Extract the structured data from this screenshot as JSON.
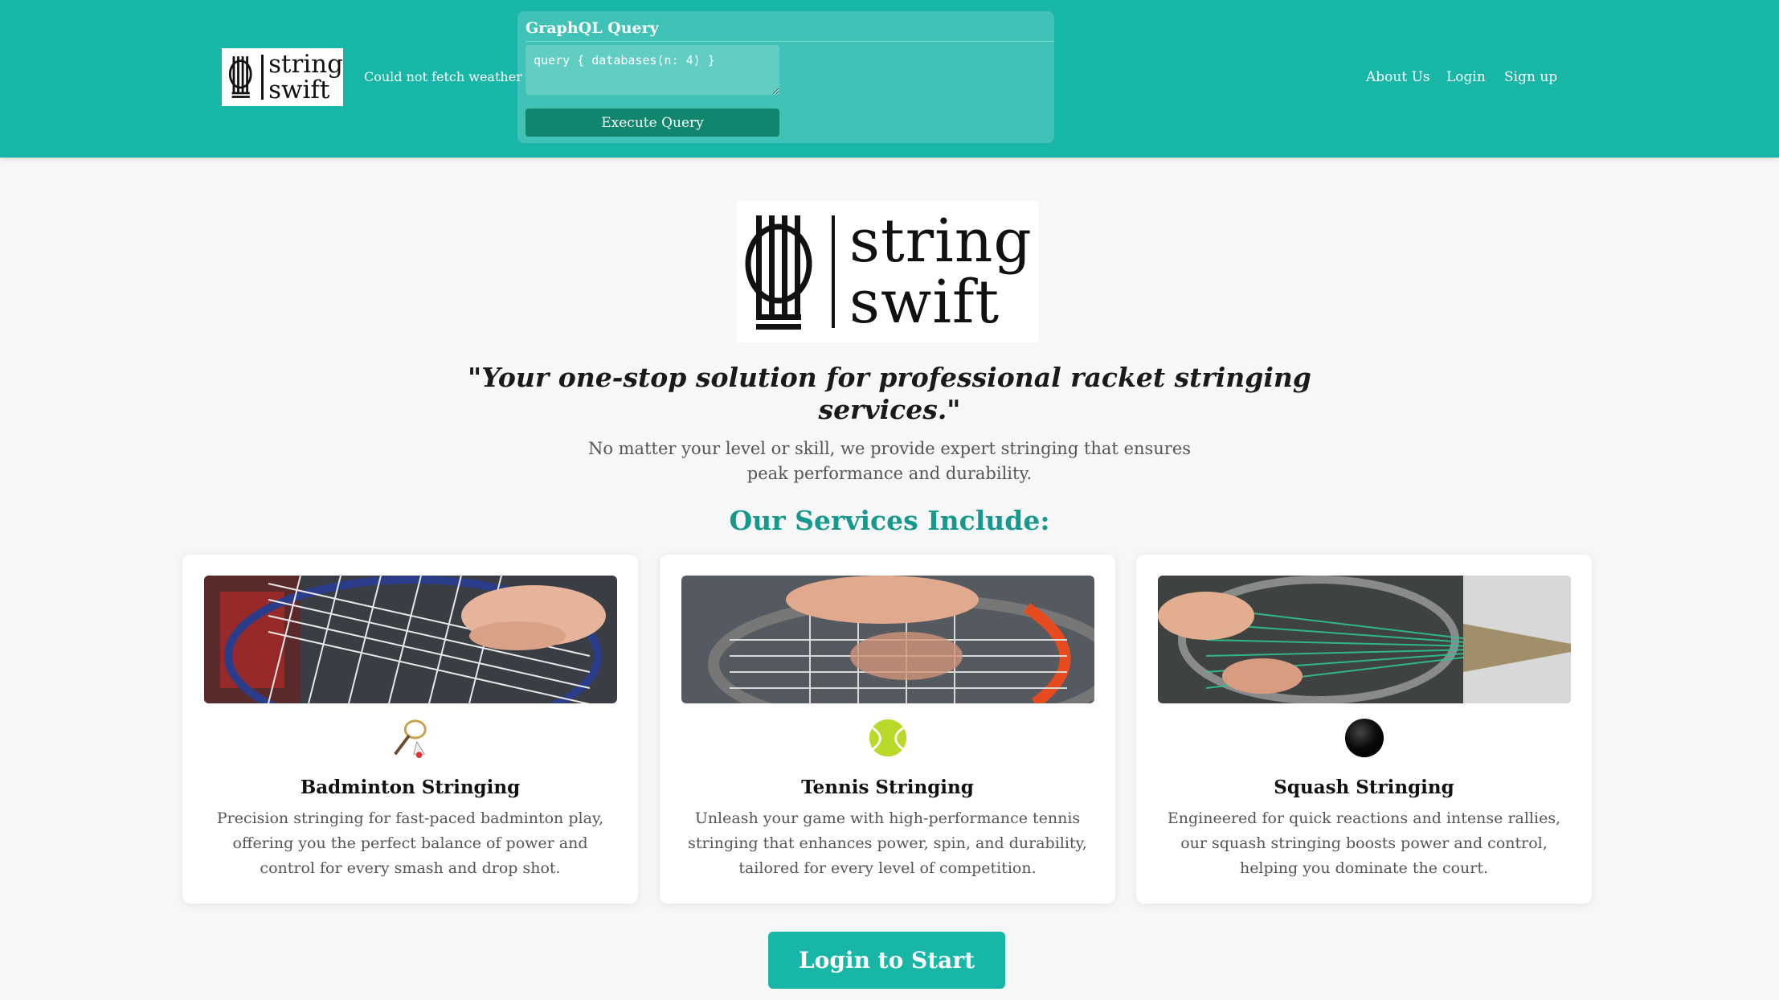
{
  "header": {
    "logo_words": [
      "string",
      "swift"
    ],
    "weather_status": "Could not fetch weather",
    "graphql": {
      "title": "GraphQL Query",
      "query_value": "query { databases(n: 4) }",
      "execute_label": "Execute Query"
    },
    "nav": [
      "About Us",
      "Login",
      "Sign up"
    ]
  },
  "hero": {
    "logo_words": [
      "string",
      "swift"
    ],
    "tagline": "\"Your one-stop solution for professional racket stringing services.\"",
    "subtitle": "No matter your level or skill, we provide expert stringing that ensures peak performance and durability.",
    "services_title": "Our Services Include:"
  },
  "services": [
    {
      "title": "Badminton Stringing",
      "icon": "badminton-icon",
      "description": "Precision stringing for fast-paced badminton play, offering you the perfect balance of power and control for every smash and drop shot."
    },
    {
      "title": "Tennis Stringing",
      "icon": "tennis-ball-icon",
      "description": "Unleash your game with high-performance tennis stringing that enhances power, spin, and durability, tailored for every level of competition."
    },
    {
      "title": "Squash Stringing",
      "icon": "squash-ball-icon",
      "description": "Engineered for quick reactions and intense rallies, our squash stringing boosts power and control, helping you dominate the court."
    }
  ],
  "cta_label": "Login to Start",
  "colors": {
    "brand_teal": "#17b6a7",
    "dark_green_button": "#10866f",
    "services_title": "#16998c"
  }
}
